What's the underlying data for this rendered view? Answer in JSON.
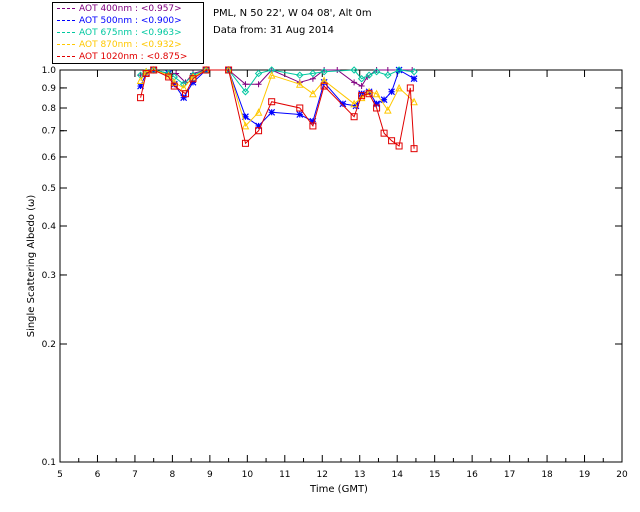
{
  "header": {
    "location": "PML, N 50 22', W 04 08', Alt 0m",
    "date": "Data from: 31 Aug 2014"
  },
  "chart_data": {
    "type": "scatter",
    "xlabel": "Time (GMT)",
    "ylabel": "Single Scattering Albedo (ω)",
    "xlim": [
      5,
      20
    ],
    "ylim": [
      0.1,
      1.0
    ],
    "yscale": "log",
    "xticks": [
      "5",
      "6",
      "7",
      "8",
      "9",
      "10",
      "11",
      "12",
      "13",
      "14",
      "15",
      "16",
      "17",
      "18",
      "19",
      "20"
    ],
    "yticks": [
      {
        "v": 1.0,
        "label": "1.0"
      },
      {
        "v": 0.9,
        "label": "0.9"
      },
      {
        "v": 0.8,
        "label": "0.8"
      },
      {
        "v": 0.7,
        "label": "0.7"
      },
      {
        "v": 0.6,
        "label": "0.6"
      },
      {
        "v": 0.5,
        "label": "0.5"
      },
      {
        "v": 0.4,
        "label": "0.4"
      },
      {
        "v": 0.3,
        "label": "0.3"
      },
      {
        "v": 0.2,
        "label": "0.2"
      },
      {
        "v": 0.1,
        "label": "0.1"
      }
    ],
    "series": [
      {
        "name": "AOT  400nm : <0.957>",
        "color": "#800080",
        "marker": "plus",
        "x": [
          7.15,
          7.3,
          7.5,
          7.9,
          8.1,
          8.35,
          8.55,
          8.9,
          9.5,
          9.95,
          10.3,
          10.65,
          11.4,
          11.75,
          12.05,
          12.4,
          12.85,
          13.05,
          13.2,
          13.45,
          13.75,
          14.05,
          14.4
        ],
        "y": [
          0.97,
          0.99,
          1.0,
          0.98,
          0.98,
          0.93,
          0.98,
          1.0,
          1.0,
          0.92,
          0.92,
          1.0,
          0.93,
          0.95,
          1.0,
          1.0,
          0.93,
          0.91,
          0.96,
          1.0,
          1.0,
          1.0,
          1.0
        ]
      },
      {
        "name": "AOT  500nm : <0.900>",
        "color": "#0000ff",
        "marker": "star",
        "x": [
          7.15,
          7.3,
          7.5,
          7.9,
          8.05,
          8.3,
          8.55,
          8.9,
          9.5,
          9.95,
          10.3,
          10.65,
          11.4,
          11.75,
          12.05,
          12.55,
          12.9,
          13.05,
          13.25,
          13.45,
          13.65,
          13.85,
          14.05,
          14.45
        ],
        "y": [
          0.91,
          0.98,
          1.0,
          0.98,
          0.92,
          0.85,
          0.93,
          1.0,
          1.0,
          0.76,
          0.72,
          0.78,
          0.77,
          0.74,
          0.93,
          0.82,
          0.81,
          0.87,
          0.88,
          0.82,
          0.84,
          0.88,
          1.0,
          0.95
        ]
      },
      {
        "name": "AOT  675nm : <0.963>",
        "color": "#00c8a0",
        "marker": "diamond",
        "x": [
          7.15,
          7.3,
          7.5,
          7.9,
          8.05,
          8.3,
          8.55,
          8.9,
          9.5,
          9.95,
          10.3,
          10.65,
          11.4,
          11.75,
          12.05,
          12.85,
          13.05,
          13.25,
          13.45,
          13.75,
          14.05,
          14.45
        ],
        "y": [
          0.97,
          0.99,
          1.0,
          0.98,
          0.96,
          0.92,
          0.97,
          1.0,
          1.0,
          0.88,
          0.98,
          1.0,
          0.97,
          0.98,
          0.99,
          1.0,
          0.95,
          0.97,
          0.99,
          0.97,
          1.0,
          0.99
        ]
      },
      {
        "name": "AOT  870nm : <0.932>",
        "color": "#ffc800",
        "marker": "triangle",
        "x": [
          7.15,
          7.3,
          7.5,
          7.9,
          8.05,
          8.3,
          8.55,
          8.9,
          9.5,
          9.95,
          10.3,
          10.65,
          11.4,
          11.75,
          12.05,
          12.85,
          13.05,
          13.25,
          13.45,
          13.75,
          14.05,
          14.45
        ],
        "y": [
          0.94,
          0.99,
          1.0,
          0.97,
          0.93,
          0.9,
          0.96,
          1.0,
          1.0,
          0.72,
          0.78,
          0.97,
          0.92,
          0.87,
          0.94,
          0.82,
          0.85,
          0.88,
          0.87,
          0.79,
          0.9,
          0.83
        ]
      },
      {
        "name": "AOT 1020nm : <0.875>",
        "color": "#e00000",
        "marker": "square",
        "x": [
          7.15,
          7.3,
          7.5,
          7.9,
          8.05,
          8.35,
          8.55,
          8.9,
          9.5,
          9.95,
          10.3,
          10.65,
          11.4,
          11.75,
          12.05,
          12.85,
          13.05,
          13.25,
          13.45,
          13.65,
          13.85,
          14.05,
          14.35,
          14.45
        ],
        "y": [
          0.85,
          0.98,
          1.0,
          0.96,
          0.91,
          0.87,
          0.95,
          1.0,
          1.0,
          0.65,
          0.7,
          0.83,
          0.8,
          0.72,
          0.91,
          0.76,
          0.86,
          0.87,
          0.8,
          0.69,
          0.66,
          0.64,
          0.9,
          0.63
        ]
      }
    ]
  }
}
